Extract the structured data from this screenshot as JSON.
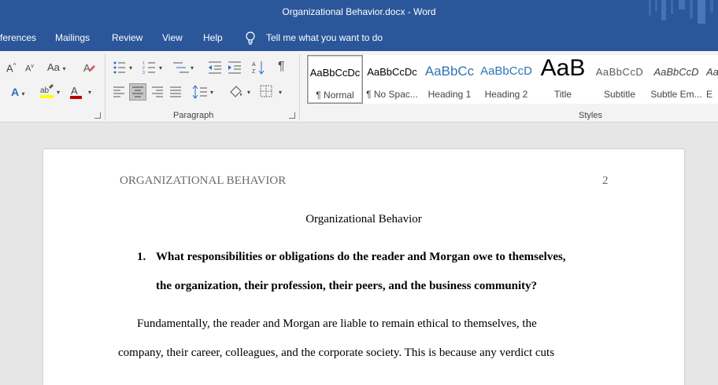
{
  "window": {
    "title": "Organizational Behavior.docx  -  Word"
  },
  "menu": {
    "references": "ferences",
    "mailings": "Mailings",
    "review": "Review",
    "view": "View",
    "help": "Help",
    "tell_me": "Tell me what you want to do"
  },
  "ribbon": {
    "paragraph_label": "Paragraph",
    "styles_label": "Styles",
    "font_grow": "A",
    "font_shrink": "A",
    "change_case": "Aa",
    "font_color_letter": "A",
    "text_effects_letter": "A",
    "pilcrow": "¶",
    "styles": [
      {
        "sample": "AaBbCcDc",
        "name": "¶ Normal"
      },
      {
        "sample": "AaBbCcDc",
        "name": "¶ No Spac..."
      },
      {
        "sample": "AaBbCc",
        "name": "Heading 1"
      },
      {
        "sample": "AaBbCcD",
        "name": "Heading 2"
      },
      {
        "sample": "AaB",
        "name": "Title"
      },
      {
        "sample": "AaBbCcD",
        "name": "Subtitle"
      },
      {
        "sample": "AaBbCcD",
        "name": "Subtle Em..."
      },
      {
        "sample": "Aa",
        "name": "E"
      }
    ]
  },
  "colors": {
    "word_blue": "#2b579a",
    "font_color_red": "#c00000",
    "highlight_yellow": "#ffff00"
  },
  "document": {
    "header_left": "ORGANIZATIONAL BEHAVIOR",
    "header_page_number": "2",
    "title": "Organizational Behavior",
    "question_number": "1.",
    "question_line1": "What responsibilities or obligations do the reader and Morgan owe to themselves,",
    "question_line2": "the organization, their profession, their peers, and the business community?",
    "paragraph_line1": "Fundamentally, the reader and Morgan are liable to remain ethical to themselves, the",
    "paragraph_line2": "company, their career, colleagues, and the corporate society. This is because any verdict cuts"
  }
}
